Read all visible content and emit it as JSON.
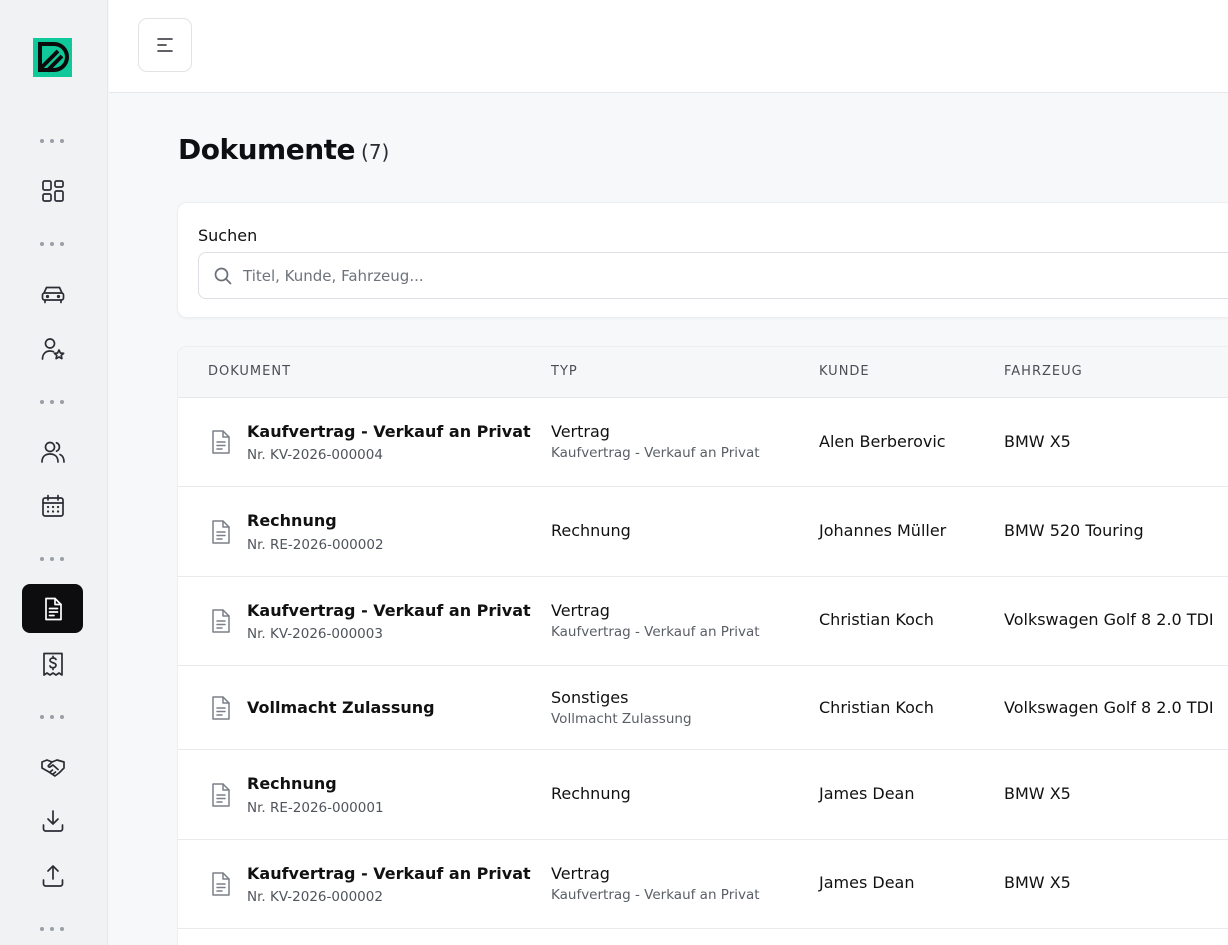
{
  "sidebar": {
    "logo": "logo",
    "items": [
      {
        "name": "dashboard",
        "icon": "dashboard-grid-icon"
      },
      {
        "name": "vehicles",
        "icon": "car-icon"
      },
      {
        "name": "customers-star",
        "icon": "user-star-icon"
      },
      {
        "name": "users",
        "icon": "users-icon"
      },
      {
        "name": "calendar",
        "icon": "calendar-icon"
      },
      {
        "name": "documents",
        "icon": "document-icon",
        "active": true
      },
      {
        "name": "invoices",
        "icon": "receipt-dollar-icon"
      },
      {
        "name": "deals",
        "icon": "handshake-icon"
      },
      {
        "name": "import",
        "icon": "download-icon"
      },
      {
        "name": "export",
        "icon": "upload-icon"
      }
    ]
  },
  "colors": {
    "brand": "#10c99a",
    "active_nav": "#0d0d0f"
  },
  "page": {
    "title": "Dokumente",
    "count": "(7)"
  },
  "search": {
    "label": "Suchen",
    "placeholder": "Titel, Kunde, Fahrzeug...",
    "value": ""
  },
  "table": {
    "headers": [
      "DOKUMENT",
      "TYP",
      "KUNDE",
      "FAHRZEUG"
    ],
    "rows": [
      {
        "title": "Kaufvertrag - Verkauf an Privat",
        "nr": "Nr. KV-2026-000004",
        "typ": "Vertrag",
        "typ_sub": "Kaufvertrag - Verkauf an Privat",
        "kunde": "Alen Berberovic",
        "fahrzeug": "BMW X5"
      },
      {
        "title": "Rechnung",
        "nr": "Nr. RE-2026-000002",
        "typ": "Rechnung",
        "typ_sub": "",
        "kunde": "Johannes Müller",
        "fahrzeug": "BMW 520 Touring"
      },
      {
        "title": "Kaufvertrag - Verkauf an Privat",
        "nr": "Nr. KV-2026-000003",
        "typ": "Vertrag",
        "typ_sub": "Kaufvertrag - Verkauf an Privat",
        "kunde": "Christian Koch",
        "fahrzeug": "Volkswagen Golf 8 2.0 TDI"
      },
      {
        "title": "Vollmacht Zulassung",
        "nr": "",
        "typ": "Sonstiges",
        "typ_sub": "Vollmacht Zulassung",
        "kunde": "Christian Koch",
        "fahrzeug": "Volkswagen Golf 8 2.0 TDI"
      },
      {
        "title": "Rechnung",
        "nr": "Nr. RE-2026-000001",
        "typ": "Rechnung",
        "typ_sub": "",
        "kunde": "James Dean",
        "fahrzeug": "BMW X5"
      },
      {
        "title": "Kaufvertrag - Verkauf an Privat",
        "nr": "Nr. KV-2026-000002",
        "typ": "Vertrag",
        "typ_sub": "Kaufvertrag - Verkauf an Privat",
        "kunde": "James Dean",
        "fahrzeug": "BMW X5"
      }
    ]
  }
}
